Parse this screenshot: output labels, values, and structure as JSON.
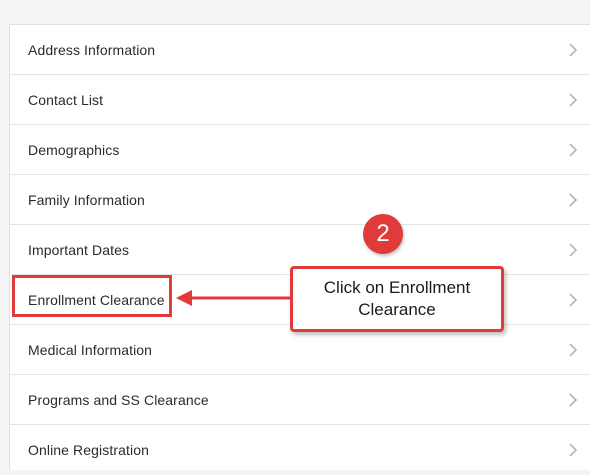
{
  "menu": {
    "items": [
      {
        "label": "Address Information",
        "icon": "chevron-right-icon"
      },
      {
        "label": "Contact List",
        "icon": "chevron-right-icon"
      },
      {
        "label": "Demographics",
        "icon": "chevron-right-icon"
      },
      {
        "label": "Family Information",
        "icon": "chevron-right-icon"
      },
      {
        "label": "Important Dates",
        "icon": "chevron-right-icon"
      },
      {
        "label": "Enrollment Clearance",
        "icon": "chevron-right-icon"
      },
      {
        "label": "Medical Information",
        "icon": "chevron-right-icon"
      },
      {
        "label": "Programs and SS Clearance",
        "icon": "chevron-right-icon"
      },
      {
        "label": "Online Registration",
        "icon": "chevron-right-icon"
      }
    ]
  },
  "annotation": {
    "step_number": "2",
    "callout_text": "Click on Enrollment Clearance",
    "accent_color": "#e03a3a"
  },
  "colors": {
    "chevron": "#b5b5b5",
    "divider": "#e4e4e4",
    "text": "#2b2b2b"
  }
}
